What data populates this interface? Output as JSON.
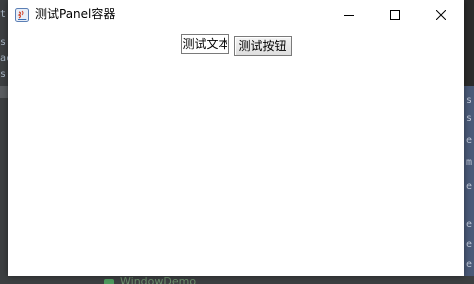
{
  "window": {
    "title": "测试Panel容器",
    "controls": {
      "minimize_icon": "minimize-icon",
      "maximize_icon": "maximize-icon",
      "close_icon": "close-icon"
    }
  },
  "panel": {
    "text_field_value": "测试文本",
    "button_label": "测试按钮"
  },
  "background": {
    "left_fragments": [
      "t",
      "s",
      "ac",
      "s"
    ],
    "right_fragments": [
      "s",
      "s",
      "e",
      "m",
      "e",
      "e",
      "e",
      "e"
    ],
    "bottom_tab": "WindowDemo"
  },
  "colors": {
    "window_bg": "#ffffff",
    "desktop_bg": "#2b2b2b",
    "ide_panel": "#3c3f41",
    "ide_highlight": "#4a5a78"
  }
}
